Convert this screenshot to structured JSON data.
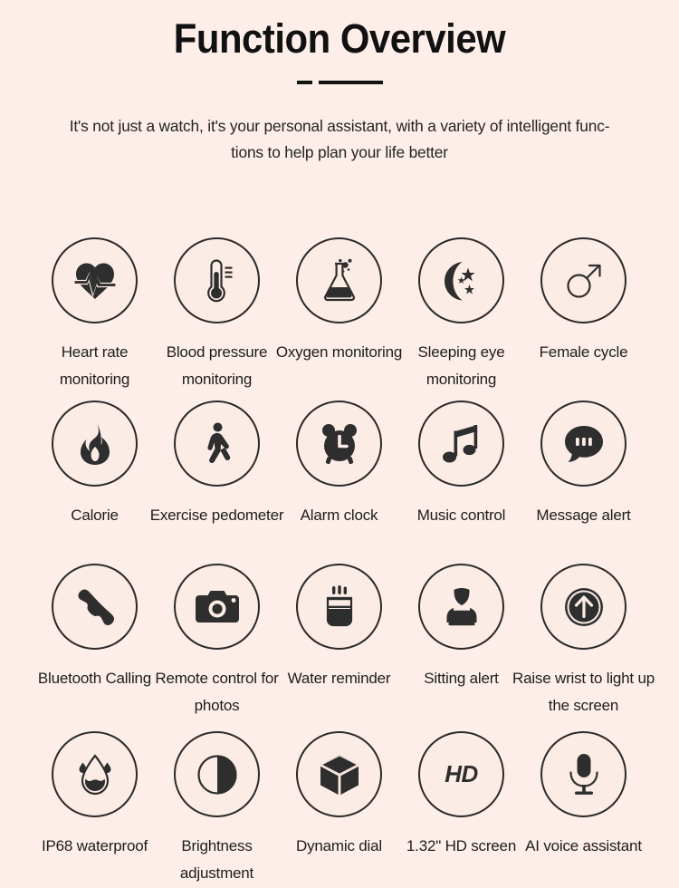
{
  "header": {
    "title": "Function Overview",
    "divider": "short-dash-long-line",
    "subtitle_line1": "It's not just a watch, it's your personal assistant, with a variety of intelligent func-",
    "subtitle_line2": "tions to help plan your life better"
  },
  "colors": {
    "background": "#fdeee9",
    "circle_fill": "#fcece6",
    "outline": "#2a2a2a",
    "icon": "#2e2e2e",
    "title": "#111111",
    "body_text": "#232323"
  },
  "features": [
    {
      "icon": "heartbeat-icon",
      "label": "Heart rate monitoring"
    },
    {
      "icon": "thermometer-icon",
      "label": "Blood pressure monitoring"
    },
    {
      "icon": "flask-icon",
      "label": "Oxygen monitoring"
    },
    {
      "icon": "moon-stars-icon",
      "label": "Sleeping eye monitoring"
    },
    {
      "icon": "mars-symbol-icon",
      "label": "Female cycle"
    },
    {
      "icon": "flame-icon",
      "label": "Calorie"
    },
    {
      "icon": "walking-person-icon",
      "label": "Exercise pedometer"
    },
    {
      "icon": "alarm-clock-icon",
      "label": "Alarm clock"
    },
    {
      "icon": "music-note-icon",
      "label": "Music control"
    },
    {
      "icon": "speech-bubble-icon",
      "label": "Message alert"
    },
    {
      "icon": "phone-handset-icon",
      "label": "Bluetooth Calling"
    },
    {
      "icon": "camera-icon",
      "label": "Remote control for photos"
    },
    {
      "icon": "water-cup-icon",
      "label": "Water reminder"
    },
    {
      "icon": "person-at-desk-icon",
      "label": "Sitting alert"
    },
    {
      "icon": "arrow-up-circle-icon",
      "label": "Raise wrist to light up the screen"
    },
    {
      "icon": "water-drop-icon",
      "label": "IP68 waterproof"
    },
    {
      "icon": "brightness-contrast-icon",
      "label": "Brightness adjustment"
    },
    {
      "icon": "cube-icon",
      "label": "Dynamic dial"
    },
    {
      "icon": "hd-badge-icon",
      "label": "1.32\" HD screen"
    },
    {
      "icon": "microphone-icon",
      "label": "AI voice assistant"
    }
  ],
  "icon_glyphs": {
    "hd_badge_text": "HD"
  }
}
